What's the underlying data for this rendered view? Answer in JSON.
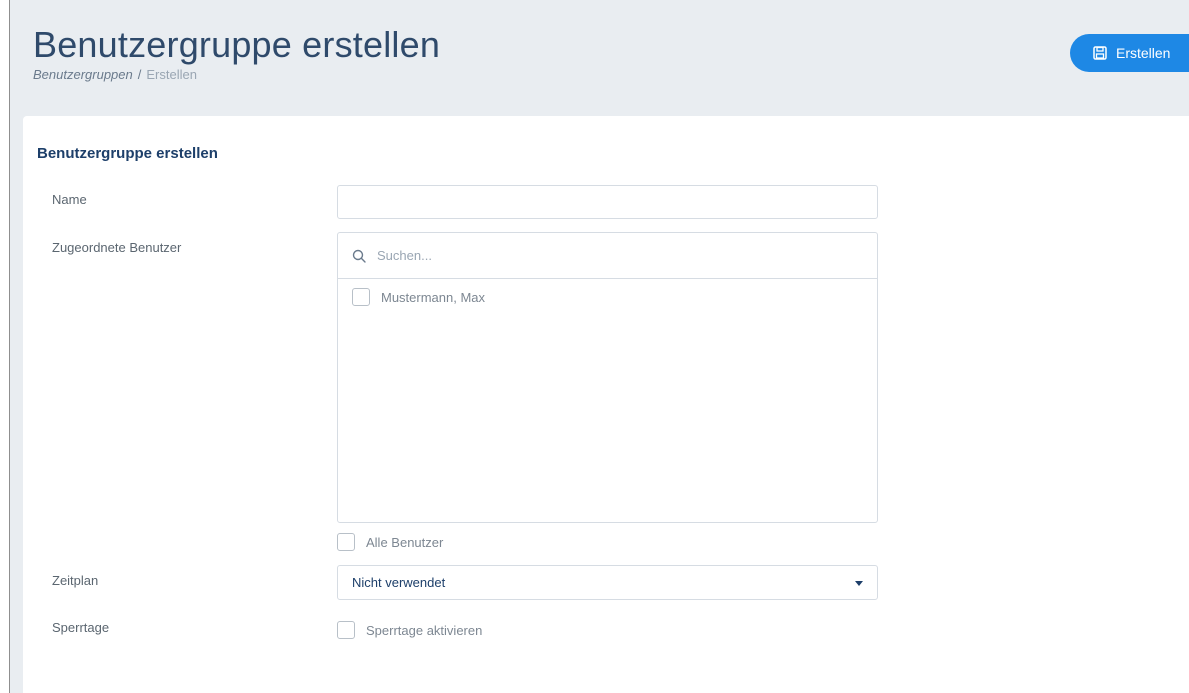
{
  "header": {
    "title": "Benutzergruppe erstellen",
    "breadcrumb": [
      "Benutzergruppen",
      "/",
      "Erstellen"
    ]
  },
  "toolbar": {
    "create_label": "Erstellen",
    "create_icon": "save-icon",
    "accent_color": "#1e88e5"
  },
  "form": {
    "section_title": "Benutzergruppe erstellen",
    "name": {
      "label": "Name",
      "value": ""
    },
    "users": {
      "label": "Zugeordnete Benutzer",
      "search_placeholder": "Suchen...",
      "items": [
        {
          "label": "Mustermann, Max",
          "checked": false
        }
      ],
      "all_users_label": "Alle Benutzer"
    },
    "schedule": {
      "label": "Zeitplan",
      "selected": "Nicht verwendet"
    },
    "blocked_days": {
      "label": "Sperrtage",
      "checkbox_label": "Sperrtage aktivieren"
    }
  }
}
